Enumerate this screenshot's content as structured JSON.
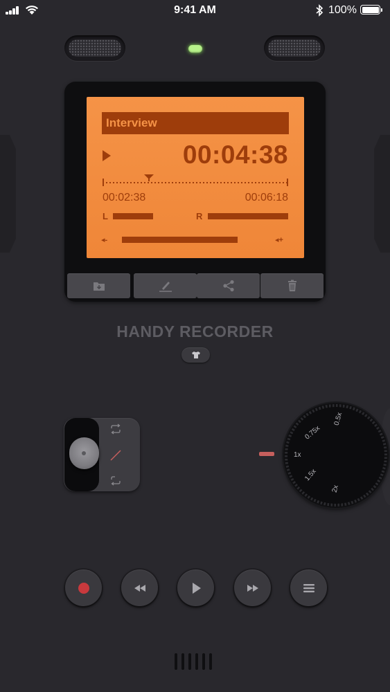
{
  "status_bar": {
    "time": "9:41 AM",
    "battery_percent": "100%",
    "icons": [
      "signal-icon",
      "wifi-icon",
      "bluetooth-icon",
      "battery-icon"
    ]
  },
  "led": {
    "color": "#b7f28a"
  },
  "lcd": {
    "title": "Interview",
    "current_time": "00:04:38",
    "elapsed": "00:02:38",
    "total": "00:06:18",
    "left_channel_label": "L",
    "right_channel_label": "R",
    "volume_down_label": "◂-",
    "volume_up_label": "◂+",
    "background_color": "#f28b3c",
    "foreground_color": "#9e3d0b"
  },
  "lcd_actions": [
    {
      "name": "save-to-folder-button",
      "icon": "folder-download-icon"
    },
    {
      "name": "rename-button",
      "icon": "pencil-icon"
    },
    {
      "name": "share-button",
      "icon": "share-icon"
    },
    {
      "name": "delete-button",
      "icon": "trash-icon"
    }
  ],
  "brand": {
    "label": "HANDY RECORDER"
  },
  "theme_button": {
    "icon": "shirt-icon"
  },
  "mode_switch": {
    "options": [
      "repeat-icon",
      "slash-icon",
      "loop-icon"
    ]
  },
  "speed_dial": {
    "labels": [
      "0.5x",
      "0.75x",
      "1x",
      "1.5x",
      "2x"
    ]
  },
  "transport": [
    {
      "name": "record-button",
      "icon": "record-icon",
      "color": "#c8393d"
    },
    {
      "name": "rewind-button",
      "icon": "rewind-icon"
    },
    {
      "name": "play-button",
      "icon": "play-icon"
    },
    {
      "name": "fast-forward-button",
      "icon": "fast-forward-icon"
    },
    {
      "name": "menu-button",
      "icon": "menu-icon"
    }
  ]
}
